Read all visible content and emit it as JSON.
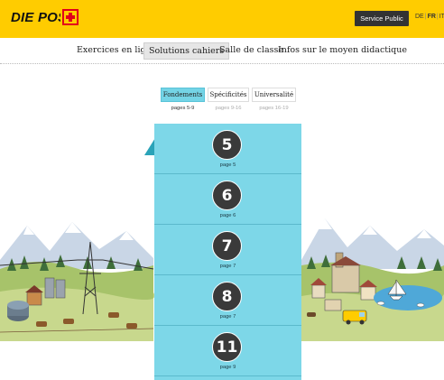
{
  "header": {
    "logo_text": "DIE POST",
    "service_label": "Service Public",
    "languages": [
      "DE",
      "FR",
      "IT"
    ],
    "active_language": "FR",
    "brand_color": "#ffcc00",
    "accent_red": "#e2001a"
  },
  "nav": {
    "items": [
      {
        "label": "Exercices en ligne"
      },
      {
        "label": "Solutions cahiers"
      },
      {
        "label": "Salle de classe"
      },
      {
        "label": "Infos sur le moyen didactique"
      }
    ],
    "selected": "Solutions cahiers"
  },
  "tabs": {
    "items": [
      {
        "label": "Fondements",
        "pages": "pages 5-9"
      },
      {
        "label": "Spécificités",
        "pages": "pages 9-16"
      },
      {
        "label": "Universalité",
        "pages": "pages 16-19"
      }
    ],
    "active": "Fondements",
    "active_color": "#74d4e6"
  },
  "cards": [
    {
      "number": "5",
      "page": "page 5"
    },
    {
      "number": "6",
      "page": "page 6"
    },
    {
      "number": "7",
      "page": "page 7"
    },
    {
      "number": "8",
      "page": "page 7"
    },
    {
      "number": "11",
      "page": "page 9"
    }
  ],
  "panel_color": "#7dd7e8",
  "illustration": {
    "description_icons": [
      "mountain-icon",
      "tree-icon",
      "pylon-icon",
      "cow-icon",
      "house-icon",
      "boat-icon",
      "van-icon"
    ]
  }
}
